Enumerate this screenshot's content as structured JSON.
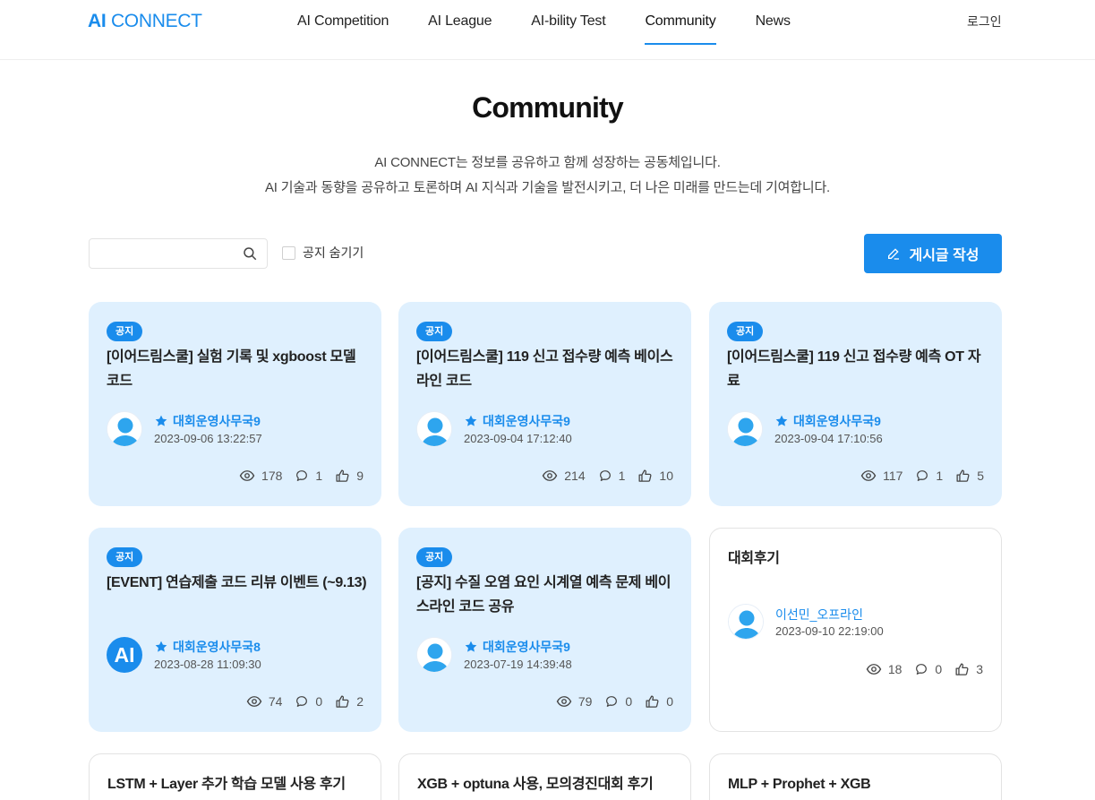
{
  "header": {
    "logo_bold": "AI",
    "logo_rest": " CONNECT",
    "nav": [
      "AI Competition",
      "AI League",
      "AI-bility Test",
      "Community",
      "News"
    ],
    "active_nav": "Community",
    "login": "로그인"
  },
  "hero": {
    "title": "Community",
    "line1": "AI CONNECT는 정보를 공유하고 함께 성장하는 공동체입니다.",
    "line2": "AI 기술과 동향을 공유하고 토론하며 AI 지식과 기술을 발전시키고, 더 나은 미래를 만드는데 기여합니다."
  },
  "toolbar": {
    "search_placeholder": "",
    "hide_notice_label": "공지 숨기기",
    "write_button": "게시글 작성"
  },
  "posts": [
    {
      "badge": "공지",
      "title": "[이어드림스쿨] 실험 기록 및 xgboost 모델 코드",
      "author": "대회운영사무국9",
      "date": "2023-09-06 13:22:57",
      "views": "178",
      "comments": "1",
      "likes": "9"
    },
    {
      "badge": "공지",
      "title": "[이어드림스쿨] 119 신고 접수량 예측 베이스라인 코드",
      "author": "대회운영사무국9",
      "date": "2023-09-04 17:12:40",
      "views": "214",
      "comments": "1",
      "likes": "10"
    },
    {
      "badge": "공지",
      "title": "[이어드림스쿨] 119 신고 접수량 예측 OT 자료",
      "author": "대회운영사무국9",
      "date": "2023-09-04 17:10:56",
      "views": "117",
      "comments": "1",
      "likes": "5"
    },
    {
      "badge": "공지",
      "title": "[EVENT] 연습제출 코드 리뷰 이벤트 (~9.13)",
      "author": "대회운영사무국8",
      "avatar_text": "AI",
      "date": "2023-08-28 11:09:30",
      "views": "74",
      "comments": "0",
      "likes": "2"
    },
    {
      "badge": "공지",
      "title": "[공지] 수질 오염 요인 시계열 예측 문제 베이스라인 코드 공유",
      "author": "대회운영사무국9",
      "date": "2023-07-19 14:39:48",
      "views": "79",
      "comments": "0",
      "likes": "0"
    },
    {
      "title": "대회후기",
      "author": "이선민_오프라인",
      "date": "2023-09-10 22:19:00",
      "views": "18",
      "comments": "0",
      "likes": "3"
    },
    {
      "title": "LSTM + Layer 추가 학습 모델 사용 후기"
    },
    {
      "title": "XGB + optuna 사용, 모의경진대회 후기"
    },
    {
      "title": "MLP + Prophet + XGB"
    }
  ],
  "colors": {
    "accent": "#1a8cec",
    "card_notice_bg": "#dff0fe"
  }
}
